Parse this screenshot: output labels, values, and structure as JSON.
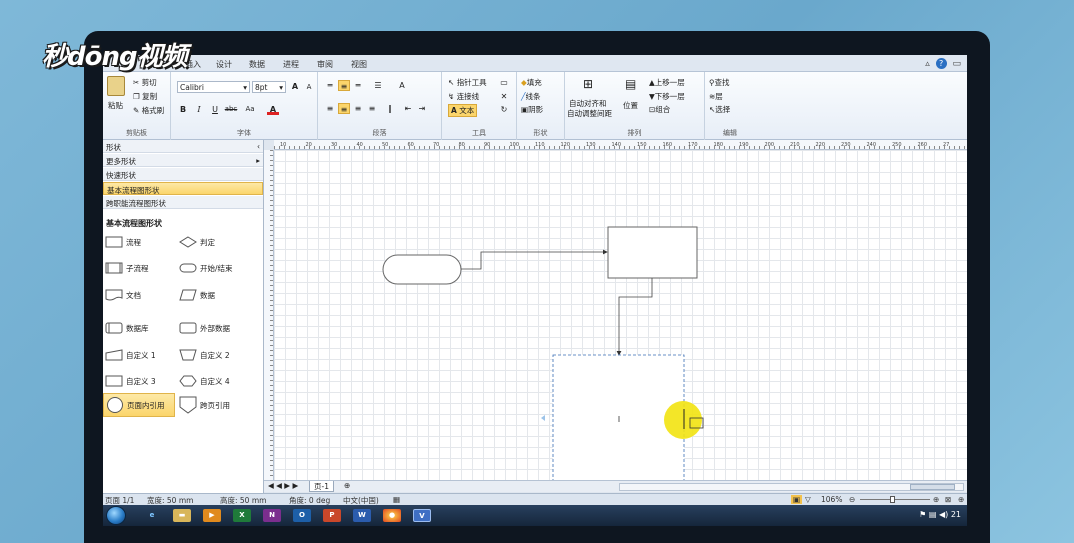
{
  "watermark": "秒dōng视频",
  "tabs": [
    "插入",
    "设计",
    "数据",
    "进程",
    "审阅",
    "视图"
  ],
  "ribbon": {
    "clipboard": {
      "paste": "粘贴",
      "cut": "剪切",
      "copy": "复制",
      "format_painter": "格式刷",
      "label": "剪贴板"
    },
    "font": {
      "name": "Calibri",
      "size": "8pt",
      "bold": "B",
      "italic": "I",
      "underline": "U",
      "strike": "abc",
      "case": "Aa",
      "grow": "A",
      "shrink": "A",
      "color": "A",
      "label": "字体"
    },
    "paragraph": {
      "label": "段落"
    },
    "tools": {
      "pointer": "指针工具",
      "connector": "连接线",
      "text": "文本",
      "label": "工具"
    },
    "shape": {
      "fill": "填充",
      "line": "线条",
      "shadow": "阴影",
      "label": "形状"
    },
    "arrange": {
      "auto_align": "自动对齐和",
      "auto_space": "自动调整间距",
      "position": "位置",
      "bring_forward": "上移一层",
      "send_backward": "下移一层",
      "group": "组合",
      "label": "排列"
    },
    "editing": {
      "find": "查找",
      "layers": "层",
      "select": "选择",
      "label": "编辑"
    }
  },
  "shapes_pane": {
    "title": "形状",
    "more_shapes": "更多形状",
    "quick_shapes": "快速形状",
    "basic_flowchart": "基本流程图形状",
    "cross_functional": "跨职能流程图形状",
    "stencil_title": "基本流程图形状",
    "items": [
      [
        "流程",
        "判定"
      ],
      [
        "子流程",
        "开始/结束"
      ],
      [
        "文档",
        "数据"
      ],
      [
        "数据库",
        "外部数据"
      ],
      [
        "自定义 1",
        "自定义 2"
      ],
      [
        "自定义 3",
        "自定义 4"
      ],
      [
        "页面内引用",
        "跨页引用"
      ]
    ]
  },
  "ruler_labels": [
    "10",
    "20",
    "30",
    "40",
    "50",
    "60",
    "70",
    "80",
    "90",
    "100",
    "110",
    "120",
    "130",
    "140",
    "150",
    "160",
    "170",
    "180",
    "190",
    "200",
    "210",
    "220",
    "230",
    "240",
    "250",
    "260",
    "27"
  ],
  "page_tab": "页-1",
  "status": {
    "page": "页面 1/1",
    "width": "宽度: 50 mm",
    "height": "高度: 50 mm",
    "angle": "角度: 0 deg",
    "language": "中文(中国)",
    "zoom": "106%"
  },
  "taskbar": {
    "clock": "21"
  }
}
